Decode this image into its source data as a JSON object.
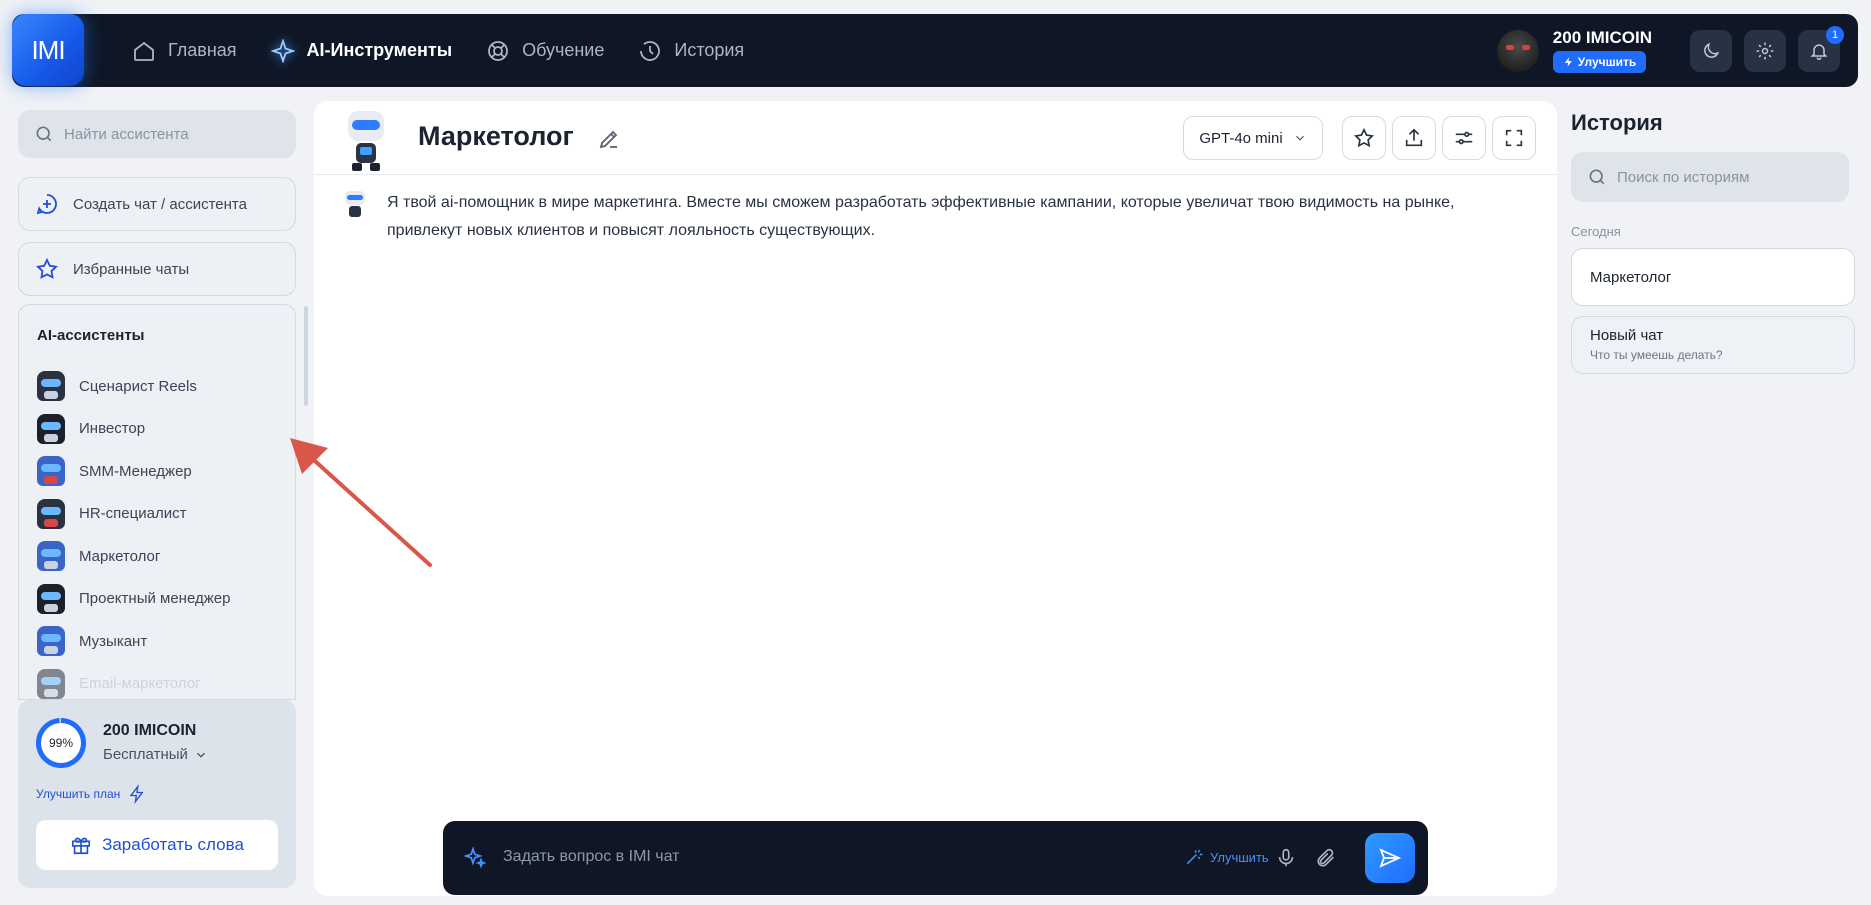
{
  "app": {
    "logo": "IMI"
  },
  "nav": {
    "items": [
      {
        "label": "Главная",
        "icon": "home-icon"
      },
      {
        "label": "AI-Инструменты",
        "icon": "sparkle-icon",
        "active": true
      },
      {
        "label": "Обучение",
        "icon": "lifebuoy-icon"
      },
      {
        "label": "История",
        "icon": "history-clock-icon"
      }
    ]
  },
  "account": {
    "coins": "200 IMICOIN",
    "upgrade": "Улучшить",
    "notifications": "1"
  },
  "sidebar": {
    "search_placeholder": "Найти ассистента",
    "create": "Создать чат / ассистента",
    "favorites": "Избранные чаты",
    "assistants_title": "AI-ассистенты",
    "assistants": [
      "Сценарист Reels",
      "Инвестор",
      "SMM-Менеджер",
      "HR-специалист",
      "Маркетолог",
      "Проектный менеджер",
      "Музыкант",
      "Email-маркетолог"
    ],
    "plan": {
      "percent": "99%",
      "percent_value": 0.99,
      "coins": "200 IMICOIN",
      "plan_name": "Бесплатный",
      "upgrade_plan": "Улучшить план",
      "earn": "Заработать слова"
    }
  },
  "chat": {
    "title": "Маркетолог",
    "model": "GPT-4o mini",
    "message": "Я твой ai-помощник в мире маркетинга. Вместе мы сможем разработать эффективные кампании, которые увеличат твою видимость на рынке, привлекут новых клиентов и повысят лояльность существующих.",
    "composer_placeholder": "Задать вопрос в IMI чат",
    "composer_upgrade": "Улучшить"
  },
  "history": {
    "title": "История",
    "search_placeholder": "Поиск по историям",
    "section": "Сегодня",
    "items": [
      {
        "title": "Маркетолог",
        "subtitle": ""
      },
      {
        "title": "Новый чат",
        "subtitle": "Что ты умеешь делать?"
      }
    ]
  },
  "colors": {
    "accent": "#1f6cff",
    "topbar": "#0f1726",
    "annotation_arrow": "#d9574a"
  }
}
